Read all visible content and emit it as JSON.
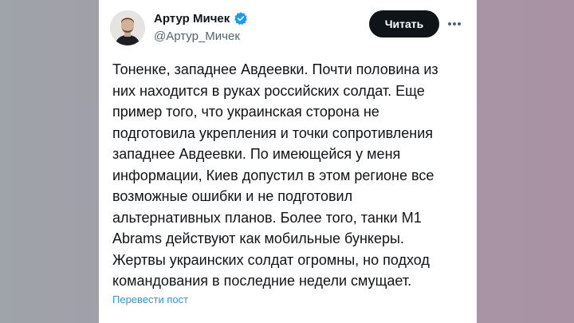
{
  "colors": {
    "text_primary": "#0f1419",
    "text_secondary": "#536471",
    "accent": "#1d9bf0",
    "button_bg": "#0f1419",
    "button_text": "#ffffff"
  },
  "author": {
    "name": "Артур Мичек",
    "handle": "@Артур_Мичек",
    "verified_icon": "verified-badge-icon",
    "avatar_icon": "avatar"
  },
  "actions": {
    "follow_label": "Читать",
    "more_icon": "more-horizontal-icon"
  },
  "tweet": {
    "text": "Тоненке, западнее Авдеевки. Почти половина из\nних находится в руках российских солдат. Еще\nпример того, что украинская сторона не\nподготовила укрепления и точки сопротивления\nзападнее Авдеевки. По имеющейся у меня\nинформации, Киев допустил в этом регионе все\nвозможные ошибки и не подготовил\nальтернативных планов. Более того, танки М1\nAbrams действуют как мобильные бункеры.\nЖертвы украинских солдат огромны, но подход\nкомандования в последние недели смущает.",
    "translate_label": "Перевести пост"
  }
}
